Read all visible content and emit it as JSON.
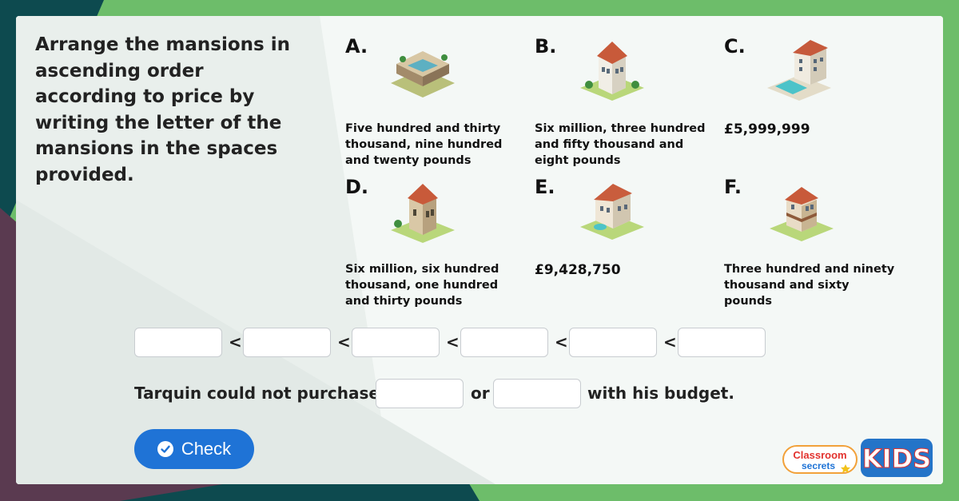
{
  "instructions": "Arrange the mansions in ascending order according to price by writing the letter of the mansions in the spaces provided.",
  "mansions": [
    {
      "letter": "A.",
      "price": "Five hundred and thirty thousand, nine hundred and twenty pounds",
      "icon": "courtyard-mansion-icon"
    },
    {
      "letter": "B.",
      "price": "Six million, three hundred and fifty thousand and eight pounds",
      "icon": "white-villa-icon"
    },
    {
      "letter": "C.",
      "price": "£5,999,999",
      "icon": "pool-mansion-icon"
    },
    {
      "letter": "D.",
      "price": "Six million, six hundred thousand, one hundred and thirty pounds",
      "icon": "castle-mansion-icon"
    },
    {
      "letter": "E.",
      "price": "£9,428,750",
      "icon": "fountain-mansion-icon"
    },
    {
      "letter": "F.",
      "price": "Three hundred and ninety thousand and sixty pounds",
      "icon": "terrace-mansion-icon"
    }
  ],
  "ordering": {
    "separator": "<",
    "answers": [
      "",
      "",
      "",
      "",
      "",
      ""
    ]
  },
  "sentence": {
    "part1": "Tarquin could not purchase",
    "part2": "or",
    "part3": "with his budget.",
    "answers": [
      "",
      ""
    ]
  },
  "check_button": {
    "label": "Check",
    "icon": "check-circle-icon"
  },
  "logos": {
    "classroom_secrets": [
      "Classroom",
      "secrets"
    ],
    "kids": "KIDS"
  },
  "colors": {
    "outer_green": "#6dbd6a",
    "dark_teal": "#0d4a4f",
    "plum": "#5a3a50",
    "button_blue": "#1f73d6",
    "card": "#f4f8f6"
  }
}
